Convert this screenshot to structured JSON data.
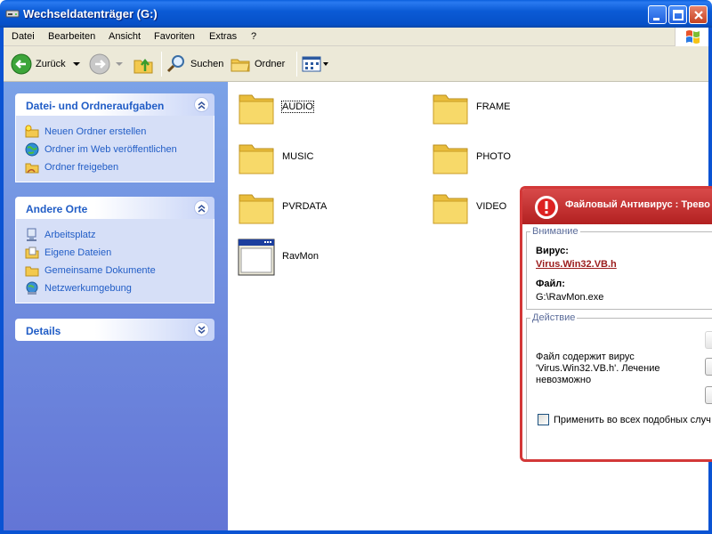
{
  "window": {
    "title": "Wechseldatenträger (G:)"
  },
  "menu": {
    "items": [
      "Datei",
      "Bearbeiten",
      "Ansicht",
      "Favoriten",
      "Extras",
      "?"
    ]
  },
  "toolbar": {
    "back_label": "Zurück",
    "search_label": "Suchen",
    "folders_label": "Ordner"
  },
  "taskpane": {
    "file_tasks": {
      "title": "Datei- und Ordneraufgaben",
      "items": [
        "Neuen Ordner erstellen",
        "Ordner im Web veröffentlichen",
        "Ordner freigeben"
      ]
    },
    "other_places": {
      "title": "Andere Orte",
      "items": [
        "Arbeitsplatz",
        "Eigene Dateien",
        "Gemeinsame Dokumente",
        "Netzwerkumgebung"
      ]
    },
    "details": {
      "title": "Details"
    }
  },
  "files": [
    {
      "name": "AUDIO",
      "type": "folder",
      "selected": true
    },
    {
      "name": "FRAME",
      "type": "folder"
    },
    {
      "name": "MUSIC",
      "type": "folder"
    },
    {
      "name": "PHOTO",
      "type": "folder"
    },
    {
      "name": "PVRDATA",
      "type": "folder"
    },
    {
      "name": "VIDEO",
      "type": "folder"
    },
    {
      "name": "RavMon",
      "type": "application"
    }
  ],
  "antivirus": {
    "title": "Файловый Антивирус : Трево",
    "attention_legend": "Внимание",
    "virus_label": "Вирус:",
    "virus_name": "Virus.Win32.VB.h",
    "file_label": "Файл:",
    "file_path": "G:\\RavMon.exe",
    "action_legend": "Действие",
    "message": "Файл содержит вирус 'Virus.Win32.VB.h'. Лечение невозможно",
    "apply_all_label": "Применить во всех подобных случ"
  },
  "colors": {
    "titlebar": "#0b5bd6",
    "taskpane_link": "#215dc6",
    "alert_red": "#d33838",
    "folder_yellow": "#f5d96a"
  }
}
